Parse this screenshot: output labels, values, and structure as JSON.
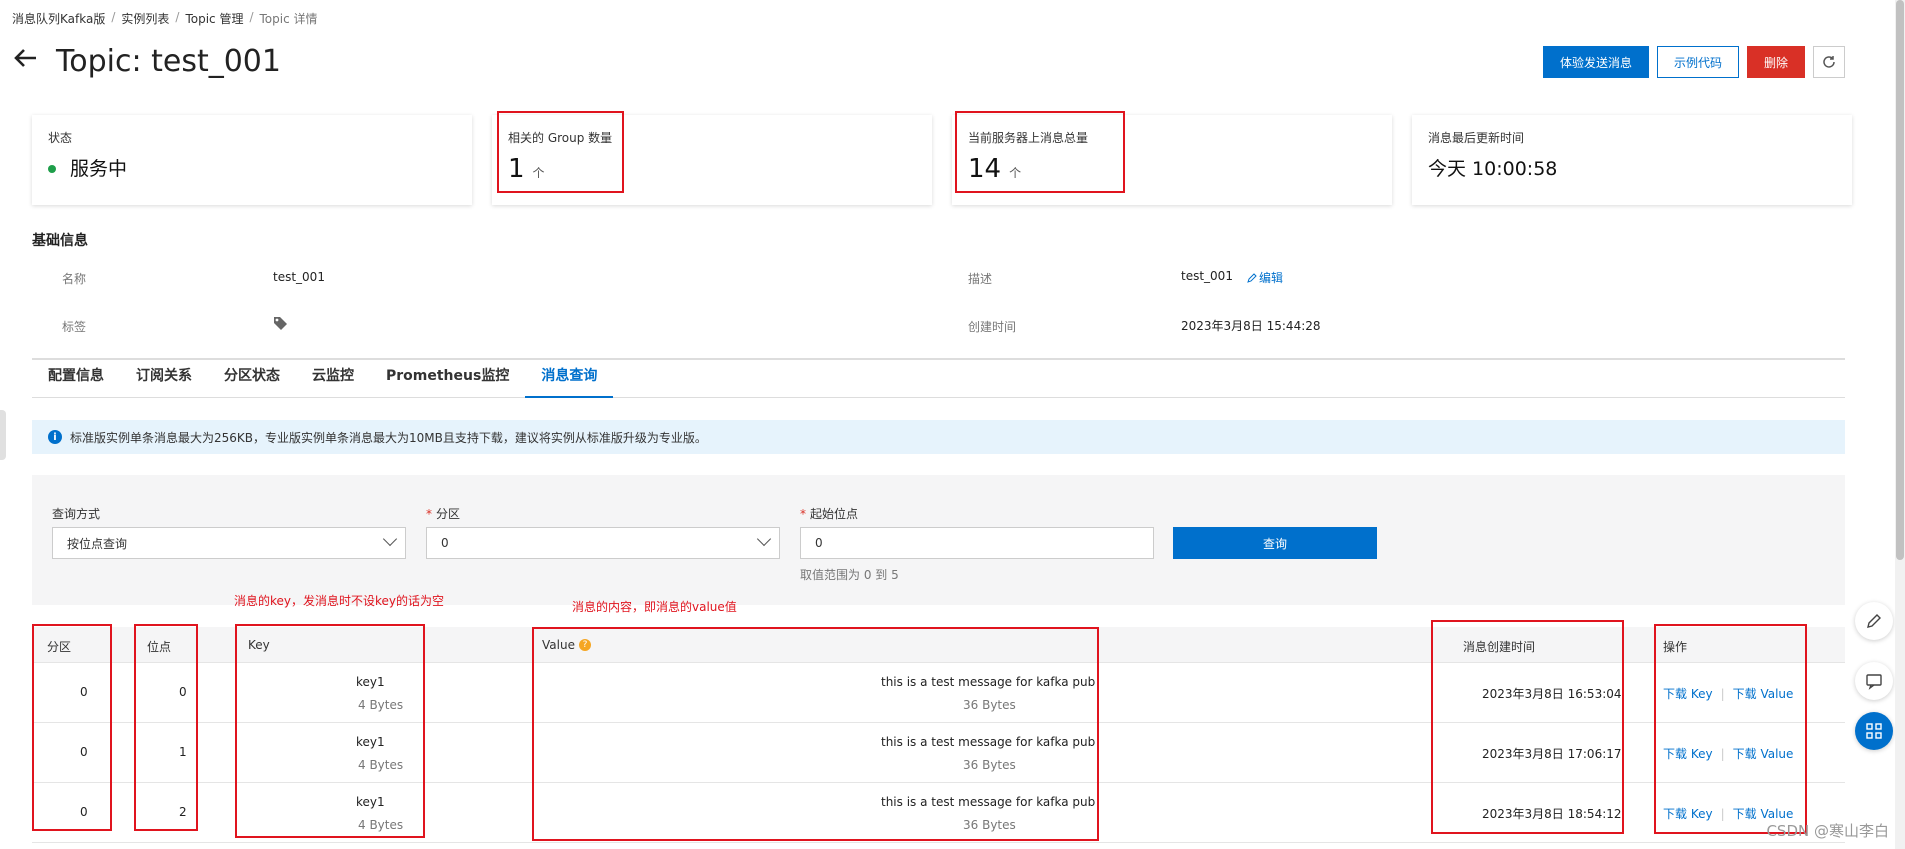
{
  "breadcrumb": [
    "消息队列Kafka版",
    "实例列表",
    "Topic 管理",
    "Topic 详情"
  ],
  "title": "Topic: test_001",
  "actions": {
    "send": "体验发送消息",
    "sample": "示例代码",
    "delete": "删除"
  },
  "cards": [
    {
      "label": "状态",
      "value": "服务中",
      "status_color": "#1e9e4a"
    },
    {
      "label": "相关的 Group 数量",
      "value": "1",
      "unit": "个"
    },
    {
      "label": "当前服务器上消息总量",
      "value": "14",
      "unit": "个"
    },
    {
      "label": "消息最后更新时间",
      "value": "今天 10:00:58"
    }
  ],
  "basic": {
    "title": "基础信息",
    "name_label": "名称",
    "name_value": "test_001",
    "desc_label": "描述",
    "desc_value": "test_001",
    "edit": "编辑",
    "tag_label": "标签",
    "created_label": "创建时间",
    "created_value": "2023年3月8日 15:44:28"
  },
  "tabs": [
    "配置信息",
    "订阅关系",
    "分区状态",
    "云监控",
    "Prometheus监控",
    "消息查询"
  ],
  "notice": "标准版实例单条消息最大为256KB，专业版实例单条消息最大为10MB且支持下载，建议将实例从标准版升级为专业版。",
  "query": {
    "mode_label": "查询方式",
    "mode_value": "按位点查询",
    "partition_label": "分区",
    "partition_value": "0",
    "offset_label": "起始位点",
    "offset_value": "0",
    "offset_hint": "取值范围为 0 到 5",
    "button": "查询"
  },
  "annotations": {
    "key_note": "消息的key，发消息时不设key的话为空",
    "value_note": "消息的内容，即消息的value值"
  },
  "table": {
    "headers": {
      "partition": "分区",
      "offset": "位点",
      "key": "Key",
      "value": "Value",
      "time": "消息创建时间",
      "ops": "操作"
    },
    "rows": [
      {
        "partition": "0",
        "offset": "0",
        "key": "key1",
        "key_size": "4 Bytes",
        "value": "this is a test message for kafka pub",
        "value_size": "36 Bytes",
        "time": "2023年3月8日 16:53:04"
      },
      {
        "partition": "0",
        "offset": "1",
        "key": "key1",
        "key_size": "4 Bytes",
        "value": "this is a test message for kafka pub",
        "value_size": "36 Bytes",
        "time": "2023年3月8日 17:06:17"
      },
      {
        "partition": "0",
        "offset": "2",
        "key": "key1",
        "key_size": "4 Bytes",
        "value": "this is a test message for kafka pub",
        "value_size": "36 Bytes",
        "time": "2023年3月8日 18:54:12"
      }
    ],
    "download_key": "下载 Key",
    "download_value": "下载 Value"
  },
  "watermark": "CSDN @寒山李白",
  "icons": [
    "back-arrow-icon",
    "refresh-icon",
    "tag-icon",
    "info-icon",
    "edit-icon",
    "help-icon",
    "feedback-icon",
    "chat-icon",
    "apps-icon"
  ],
  "colors": {
    "primary": "#0070cc",
    "danger": "#d93026",
    "annotation": "#e0141e",
    "notice_bg": "#e6f3fc"
  }
}
